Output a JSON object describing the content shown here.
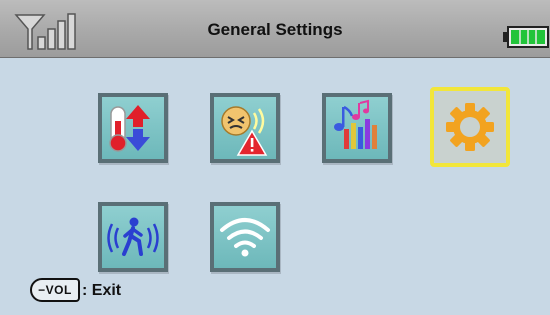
{
  "header": {
    "title": "General Settings",
    "signal_icon": "signal-strength-icon",
    "battery_icon": "battery-full-icon"
  },
  "menu": {
    "items": [
      {
        "icon": "temperature-icon",
        "selected": false
      },
      {
        "icon": "noise-alert-icon",
        "selected": false
      },
      {
        "icon": "music-equalizer-icon",
        "selected": false
      },
      {
        "icon": "gear-icon",
        "selected": true
      },
      {
        "icon": "motion-sensor-icon",
        "selected": false
      },
      {
        "icon": "wifi-icon",
        "selected": false
      }
    ]
  },
  "footer": {
    "vol_key": "−VOL",
    "exit_label": ": Exit"
  },
  "colors": {
    "background": "#c8d8e5",
    "tile": "#7cc4c5",
    "tile_border": "#5a6f76",
    "selection": "#f2e63a",
    "battery": "#22c43a"
  }
}
